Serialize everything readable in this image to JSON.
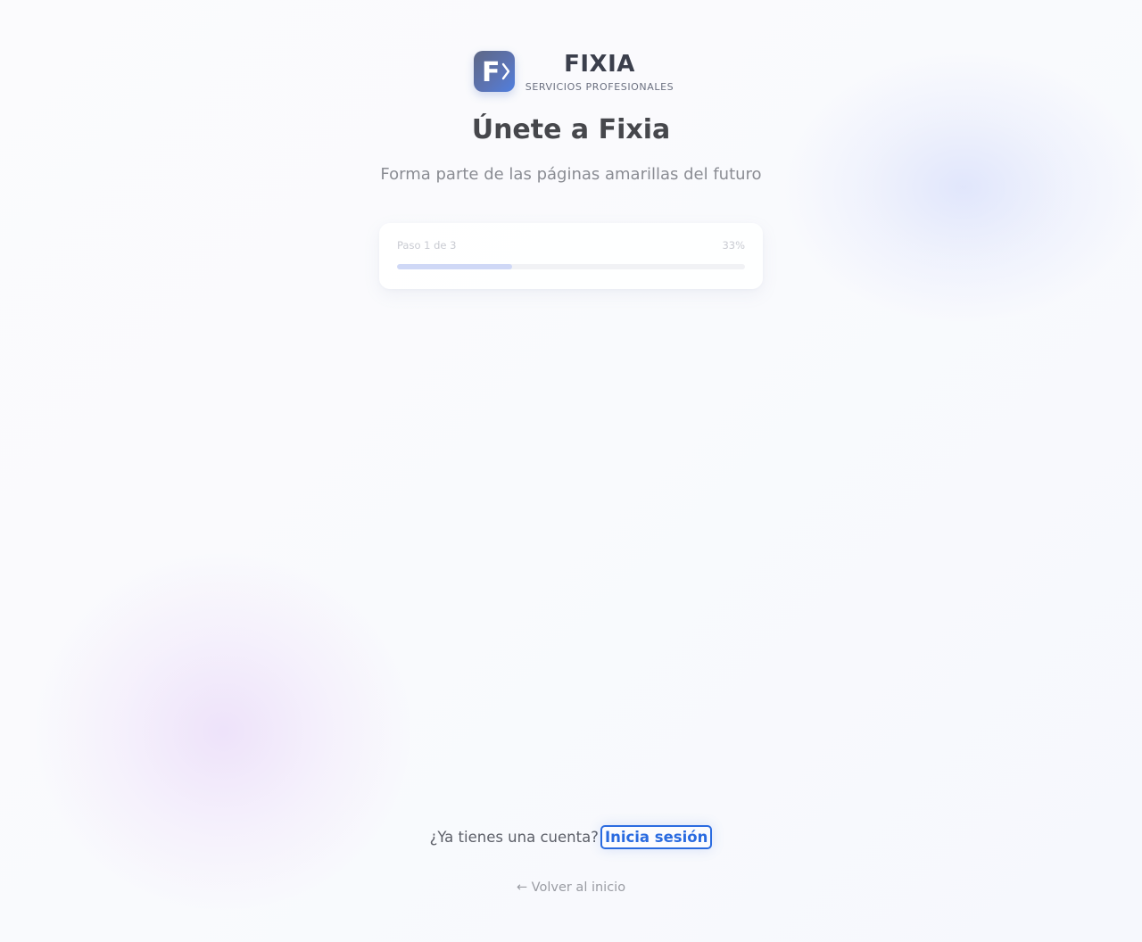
{
  "brand": {
    "logo_icon": "fixia-logo-icon",
    "logo_letter": "F",
    "name": "FIXIA",
    "tagline": "SERVICIOS PROFESIONALES"
  },
  "heading": {
    "title": "Únete a Fixia",
    "subtitle": "Forma parte de las páginas amarillas del futuro"
  },
  "progress": {
    "step_label": "Paso 1 de 3",
    "percent_label": "33%",
    "value": 0.33
  },
  "footer": {
    "login_prompt": "¿Ya tienes una cuenta?",
    "login_link": "Inicia sesión",
    "back_link": "← Volver al inicio"
  },
  "colors": {
    "accent": "#2a6be0",
    "text_dark": "#46474c",
    "text_muted": "#8a8c93",
    "progress_fill": "#cfd8f6"
  }
}
